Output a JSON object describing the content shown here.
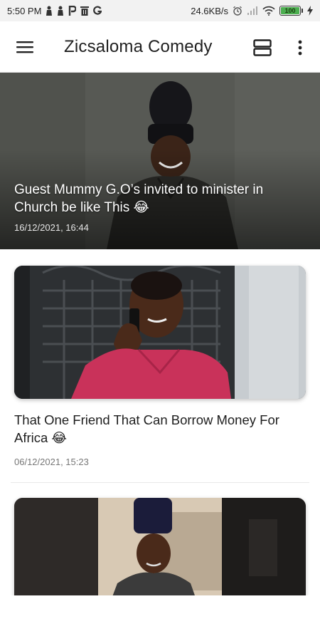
{
  "status_bar": {
    "time": "5:50 PM",
    "notification_icons": [
      "person-icon",
      "person-icon",
      "pinterest-icon",
      "trash-icon",
      "google-icon"
    ],
    "net_speed": "24.6KB/s",
    "battery": "100",
    "battery_level": 1.0,
    "battery_color": "#4caf50"
  },
  "app_bar": {
    "title": "Zicsaloma Comedy",
    "menu_icon": "hamburger-menu-icon",
    "layout_icon": "view-toggle-icon",
    "more_icon": "more-vertical-icon"
  },
  "featured": {
    "title": "Guest Mummy G.O’s invited to minister in Church be like This 😂",
    "date": "16/12/2021, 16:44"
  },
  "posts": [
    {
      "title": "That One Friend That Can Borrow Money For Africa 😂",
      "date": "06/12/2021, 15:23"
    }
  ]
}
